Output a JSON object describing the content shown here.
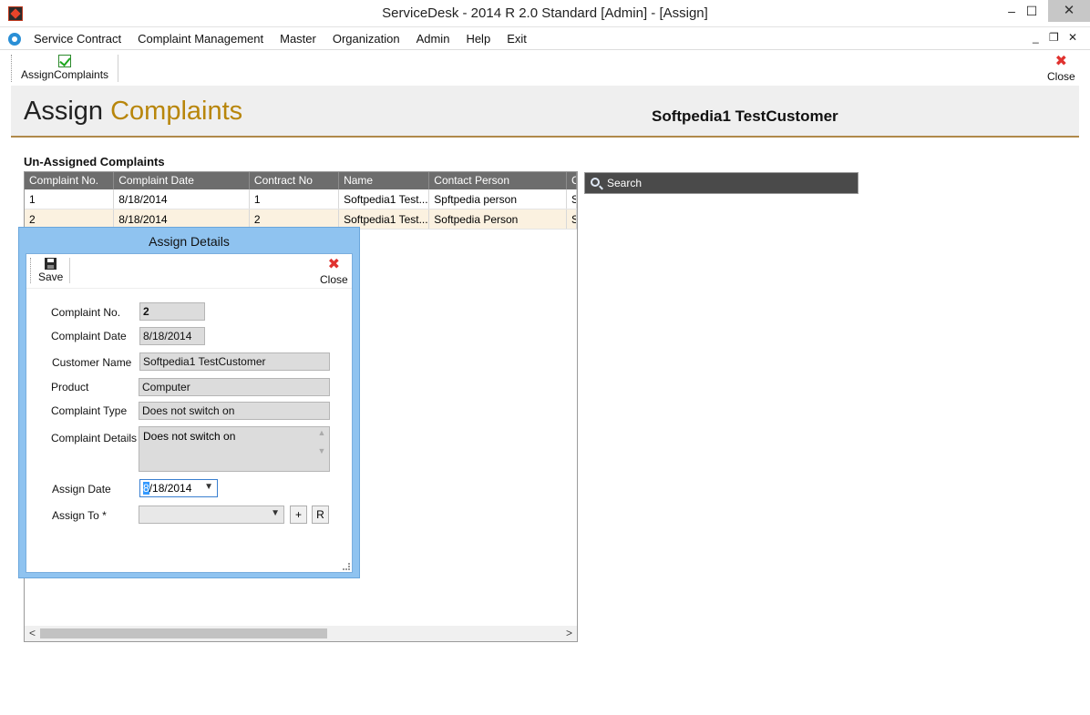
{
  "window": {
    "title": "ServiceDesk - 2014 R 2.0 Standard [Admin] - [Assign]",
    "minimize": "–",
    "maximize": "☐",
    "close": "✕"
  },
  "menu": {
    "items": [
      "Service Contract",
      "Complaint Management",
      "Master",
      "Organization",
      "Admin",
      "Help",
      "Exit"
    ],
    "mdi_min": "_",
    "mdi_restore": "❐",
    "mdi_close": "✕"
  },
  "toolbar": {
    "assign_label": "AssignComplaints",
    "close_label": "Close"
  },
  "header": {
    "title_main": "Assign",
    "title_accent": "Complaints",
    "customer": "Softpedia1 TestCustomer"
  },
  "grid": {
    "section_label": "Un-Assigned Complaints",
    "columns": [
      "Complaint No.",
      "Complaint Date",
      "Contract No",
      "Name",
      "Contact Person",
      "C"
    ],
    "rows": [
      [
        "1",
        "8/18/2014",
        "1",
        "Softpedia1 Test...",
        "Spftpedia person",
        "S"
      ],
      [
        "2",
        "8/18/2014",
        "2",
        "Softpedia1 Test...",
        "Softpedia Person",
        "S"
      ]
    ],
    "scroll_left": "<",
    "scroll_right": ">"
  },
  "search": {
    "label": "Search"
  },
  "dialog": {
    "title": "Assign Details",
    "save_label": "Save",
    "close_label": "Close",
    "labels": {
      "complaint_no": "Complaint No.",
      "complaint_date": "Complaint Date",
      "customer_name": "Customer Name",
      "product": "Product",
      "complaint_type": "Complaint Type",
      "complaint_details": "Complaint Details",
      "assign_date": "Assign Date",
      "assign_to": "Assign To *"
    },
    "values": {
      "complaint_no": "2",
      "complaint_date": "8/18/2014",
      "customer_name": "Softpedia1 TestCustomer",
      "product": "Computer",
      "complaint_type": "Does not switch on",
      "complaint_details": "Does not switch on",
      "assign_date_sel": "8",
      "assign_date_rest": "/18/2014",
      "assign_to": ""
    },
    "add_btn": "+",
    "refresh_btn": "R"
  },
  "colors": {
    "accent": "#b8860b",
    "dialog_frame": "#8fc3f0",
    "grid_header": "#6d6d6d",
    "row_alt": "#fbf1e0"
  }
}
